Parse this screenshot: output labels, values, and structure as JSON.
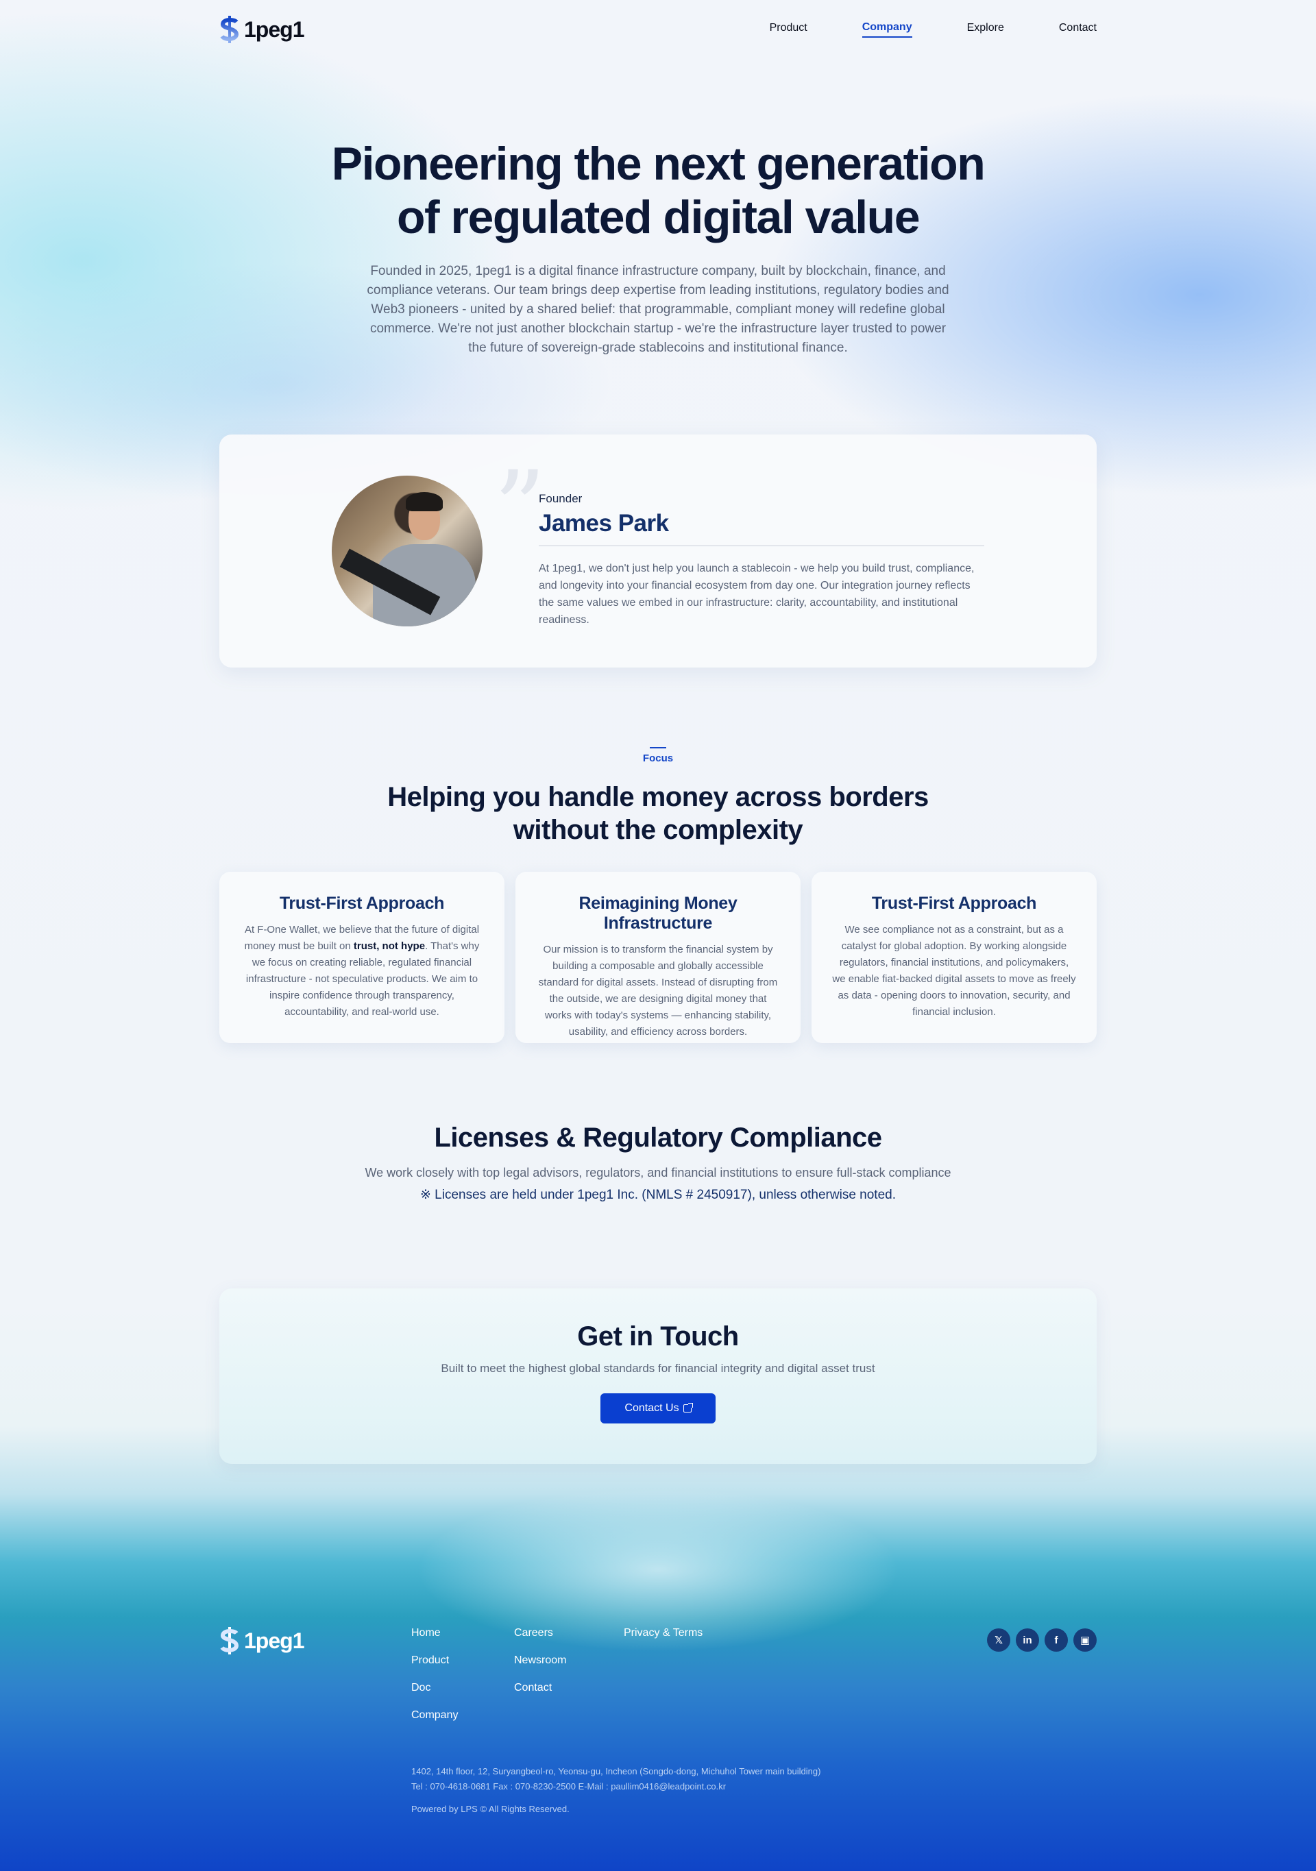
{
  "header": {
    "logo_text": "1peg1",
    "nav": [
      {
        "label": "Product",
        "active": false
      },
      {
        "label": "Company",
        "active": true
      },
      {
        "label": "Explore",
        "active": false
      },
      {
        "label": "Contact",
        "active": false
      }
    ]
  },
  "hero": {
    "title_line1": "Pioneering the next generation",
    "title_line2": "of regulated digital value",
    "description": "Founded in 2025, 1peg1 is a digital finance infrastructure company, built by blockchain, finance, and compliance veterans. Our team brings deep expertise from leading institutions, regulatory bodies and Web3 pioneers - united by a shared belief: that programmable, compliant money will redefine global commerce. We're not just another blockchain startup - we're the infrastructure layer trusted to power the future of sovereign-grade stablecoins and institutional finance."
  },
  "founder": {
    "role": "Founder",
    "name": "James Park",
    "quote": "At 1peg1, we don't just help you launch a stablecoin - we help you build trust, compliance, and longevity into your financial ecosystem from day one. Our integration journey reflects the same values we embed in our infrastructure: clarity, accountability, and institutional readiness."
  },
  "focus": {
    "label": "Focus",
    "title_line1": "Helping you handle money across borders",
    "title_line2": "without the complexity",
    "cards": [
      {
        "title": "Trust-First Approach",
        "text_before": "At F-One Wallet, we believe that the future of digital money must be built on ",
        "text_bold": "trust, not hype",
        "text_after": ". That's why we focus on creating reliable, regulated financial infrastructure - not speculative products. We aim to inspire confidence through transparency, accountability, and real-world use."
      },
      {
        "title": "Reimagining Money Infrastructure",
        "text": "Our mission is to transform the financial system by building a composable and globally accessible standard for digital assets. Instead of disrupting from the outside, we are designing digital money that works with today's systems — enhancing stability, usability, and efficiency across borders."
      },
      {
        "title": "Trust-First Approach",
        "text": "We see compliance not as a constraint, but as a catalyst for global adoption. By working alongside regulators, financial institutions, and policymakers, we enable fiat-backed digital assets to move as freely as data - opening doors to innovation, security, and financial inclusion."
      }
    ]
  },
  "licenses": {
    "title": "Licenses & Regulatory Compliance",
    "subtitle": "We work closely with top legal advisors, regulators, and financial institutions to ensure full-stack compliance",
    "note": "※ Licenses are held under 1peg1 Inc. (NMLS # 2450917), unless otherwise noted."
  },
  "contact": {
    "title": "Get in Touch",
    "subtitle": "Built to meet the highest global standards for financial integrity and digital asset trust",
    "button_label": "Contact Us"
  },
  "footer": {
    "logo_text": "1peg1",
    "col1": [
      "Home",
      "Product",
      "Doc",
      "Company"
    ],
    "col2": [
      "Careers",
      "Newsroom",
      "Contact"
    ],
    "col3": [
      "Privacy & Terms"
    ],
    "social": [
      {
        "icon": "x-icon",
        "glyph": "𝕏"
      },
      {
        "icon": "linkedin-icon",
        "glyph": "in"
      },
      {
        "icon": "facebook-icon",
        "glyph": "f"
      },
      {
        "icon": "blog-icon",
        "glyph": "▣"
      }
    ],
    "address": "1402, 14th floor, 12, Suryangbeol-ro, Yeonsu-gu, Incheon (Songdo-dong, Michuhol Tower main building)",
    "contact_line": "Tel : 070-4618-0681 Fax : 070-8230-2500 E-Mail : paullim0416@leadpoint.co.kr",
    "powered": "Powered by LPS © All Rights Reserved."
  },
  "colors": {
    "accent": "#1446c8",
    "heading": "#0c1836",
    "button": "#0a3fd0"
  }
}
